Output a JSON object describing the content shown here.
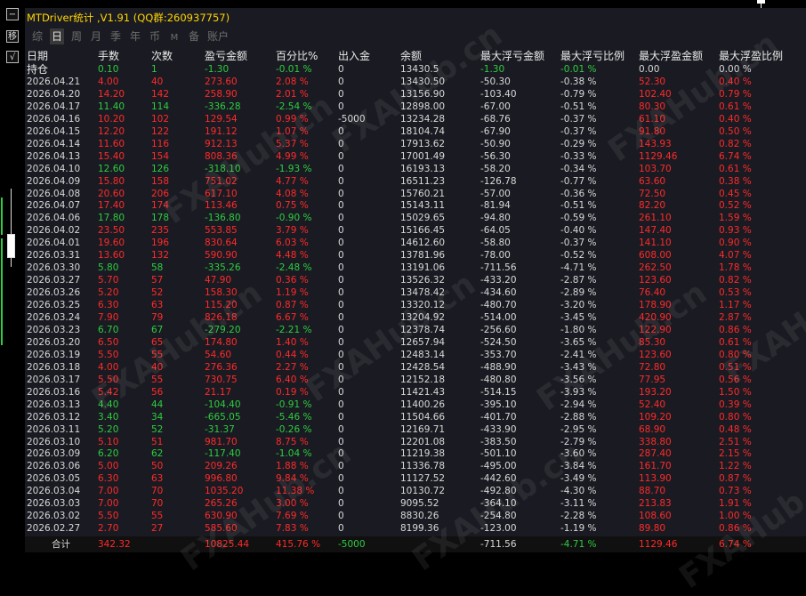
{
  "window": {
    "title": "MTDriver统计 ,V1.91 (QQ群:260937757)",
    "side_buttons": [
      "−",
      "移",
      "√"
    ]
  },
  "tabs": [
    {
      "label": "综",
      "active": false,
      "small": false
    },
    {
      "label": "日",
      "active": true,
      "small": false
    },
    {
      "label": "周",
      "active": false,
      "small": false
    },
    {
      "label": "月",
      "active": false,
      "small": false
    },
    {
      "label": "季",
      "active": false,
      "small": false
    },
    {
      "label": "年",
      "active": false,
      "small": false
    },
    {
      "label": "币",
      "active": false,
      "small": false
    },
    {
      "label": "M",
      "active": false,
      "small": true
    },
    {
      "label": "备",
      "active": false,
      "small": false
    },
    {
      "label": "账户",
      "active": false,
      "small": false
    }
  ],
  "columns": [
    "日期",
    "手数",
    "次数",
    "盈亏金额",
    "百分比%",
    "出入金",
    "余额",
    "最大浮亏金额",
    "最大浮亏比例",
    "最大浮盈金额",
    "最大浮盈比例"
  ],
  "holding": {
    "date": "持仓",
    "lots": "0.10",
    "count": "1",
    "pnl": "-1.30",
    "pct": "-0.01 %",
    "io": "0",
    "balance": "13430.5",
    "max_loss": "-1.30",
    "max_loss_pct": "-0.01 %",
    "max_profit": "0.00",
    "max_profit_pct": "0.00 %"
  },
  "rows": [
    {
      "date": "2026.04.21",
      "lots": "4.00",
      "count": "40",
      "pnl": "273.60",
      "pct": "2.08 %",
      "io": "0",
      "balance": "13430.50",
      "max_loss": "-50.30",
      "max_loss_pct": "-0.38 %",
      "max_profit": "52.30",
      "max_profit_pct": "0.40 %"
    },
    {
      "date": "2026.04.20",
      "lots": "14.20",
      "count": "142",
      "pnl": "258.90",
      "pct": "2.01 %",
      "io": "0",
      "balance": "13156.90",
      "max_loss": "-103.40",
      "max_loss_pct": "-0.79 %",
      "max_profit": "102.40",
      "max_profit_pct": "0.79 %"
    },
    {
      "date": "2026.04.17",
      "lots": "11.40",
      "count": "114",
      "pnl": "-336.28",
      "pct": "-2.54 %",
      "io": "0",
      "balance": "12898.00",
      "max_loss": "-67.00",
      "max_loss_pct": "-0.51 %",
      "max_profit": "80.30",
      "max_profit_pct": "0.61 %"
    },
    {
      "date": "2026.04.16",
      "lots": "10.20",
      "count": "102",
      "pnl": "129.54",
      "pct": "0.99 %",
      "io": "-5000",
      "balance": "13234.28",
      "max_loss": "-68.76",
      "max_loss_pct": "-0.37 %",
      "max_profit": "61.10",
      "max_profit_pct": "0.40 %"
    },
    {
      "date": "2026.04.15",
      "lots": "12.20",
      "count": "122",
      "pnl": "191.12",
      "pct": "1.07 %",
      "io": "0",
      "balance": "18104.74",
      "max_loss": "-67.90",
      "max_loss_pct": "-0.37 %",
      "max_profit": "91.80",
      "max_profit_pct": "0.50 %"
    },
    {
      "date": "2026.04.14",
      "lots": "11.60",
      "count": "116",
      "pnl": "912.13",
      "pct": "5.37 %",
      "io": "0",
      "balance": "17913.62",
      "max_loss": "-50.90",
      "max_loss_pct": "-0.29 %",
      "max_profit": "143.93",
      "max_profit_pct": "0.82 %"
    },
    {
      "date": "2026.04.13",
      "lots": "15.40",
      "count": "154",
      "pnl": "808.36",
      "pct": "4.99 %",
      "io": "0",
      "balance": "17001.49",
      "max_loss": "-56.30",
      "max_loss_pct": "-0.33 %",
      "max_profit": "1129.46",
      "max_profit_pct": "6.74 %"
    },
    {
      "date": "2026.04.10",
      "lots": "12.60",
      "count": "126",
      "pnl": "-318.10",
      "pct": "-1.93 %",
      "io": "0",
      "balance": "16193.13",
      "max_loss": "-58.20",
      "max_loss_pct": "-0.34 %",
      "max_profit": "103.70",
      "max_profit_pct": "0.61 %"
    },
    {
      "date": "2026.04.09",
      "lots": "15.80",
      "count": "158",
      "pnl": "751.02",
      "pct": "4.77 %",
      "io": "0",
      "balance": "16511.23",
      "max_loss": "-126.78",
      "max_loss_pct": "-0.77 %",
      "max_profit": "63.60",
      "max_profit_pct": "0.38 %"
    },
    {
      "date": "2026.04.08",
      "lots": "20.60",
      "count": "206",
      "pnl": "617.10",
      "pct": "4.08 %",
      "io": "0",
      "balance": "15760.21",
      "max_loss": "-57.00",
      "max_loss_pct": "-0.36 %",
      "max_profit": "72.50",
      "max_profit_pct": "0.45 %"
    },
    {
      "date": "2026.04.07",
      "lots": "17.40",
      "count": "174",
      "pnl": "113.46",
      "pct": "0.75 %",
      "io": "0",
      "balance": "15143.11",
      "max_loss": "-81.94",
      "max_loss_pct": "-0.51 %",
      "max_profit": "82.20",
      "max_profit_pct": "0.52 %"
    },
    {
      "date": "2026.04.06",
      "lots": "17.80",
      "count": "178",
      "pnl": "-136.80",
      "pct": "-0.90 %",
      "io": "0",
      "balance": "15029.65",
      "max_loss": "-94.80",
      "max_loss_pct": "-0.59 %",
      "max_profit": "261.10",
      "max_profit_pct": "1.59 %"
    },
    {
      "date": "2026.04.02",
      "lots": "23.50",
      "count": "235",
      "pnl": "553.85",
      "pct": "3.79 %",
      "io": "0",
      "balance": "15166.45",
      "max_loss": "-64.05",
      "max_loss_pct": "-0.40 %",
      "max_profit": "147.40",
      "max_profit_pct": "0.93 %"
    },
    {
      "date": "2026.04.01",
      "lots": "19.60",
      "count": "196",
      "pnl": "830.64",
      "pct": "6.03 %",
      "io": "0",
      "balance": "14612.60",
      "max_loss": "-58.80",
      "max_loss_pct": "-0.37 %",
      "max_profit": "141.10",
      "max_profit_pct": "0.90 %"
    },
    {
      "date": "2026.03.31",
      "lots": "13.60",
      "count": "132",
      "pnl": "590.90",
      "pct": "4.48 %",
      "io": "0",
      "balance": "13781.96",
      "max_loss": "-78.00",
      "max_loss_pct": "-0.52 %",
      "max_profit": "608.00",
      "max_profit_pct": "4.07 %"
    },
    {
      "date": "2026.03.30",
      "lots": "5.80",
      "count": "58",
      "pnl": "-335.26",
      "pct": "-2.48 %",
      "io": "0",
      "balance": "13191.06",
      "max_loss": "-711.56",
      "max_loss_pct": "-4.71 %",
      "max_profit": "262.50",
      "max_profit_pct": "1.78 %"
    },
    {
      "date": "2026.03.27",
      "lots": "5.70",
      "count": "57",
      "pnl": "47.90",
      "pct": "0.36 %",
      "io": "0",
      "balance": "13526.32",
      "max_loss": "-433.20",
      "max_loss_pct": "-2.87 %",
      "max_profit": "123.60",
      "max_profit_pct": "0.82 %"
    },
    {
      "date": "2026.03.26",
      "lots": "5.20",
      "count": "52",
      "pnl": "158.30",
      "pct": "1.19 %",
      "io": "0",
      "balance": "13478.42",
      "max_loss": "-434.60",
      "max_loss_pct": "-2.89 %",
      "max_profit": "76.40",
      "max_profit_pct": "0.53 %"
    },
    {
      "date": "2026.03.25",
      "lots": "6.30",
      "count": "63",
      "pnl": "115.20",
      "pct": "0.87 %",
      "io": "0",
      "balance": "13320.12",
      "max_loss": "-480.70",
      "max_loss_pct": "-3.20 %",
      "max_profit": "178.90",
      "max_profit_pct": "1.17 %"
    },
    {
      "date": "2026.03.24",
      "lots": "7.90",
      "count": "79",
      "pnl": "826.18",
      "pct": "6.67 %",
      "io": "0",
      "balance": "13204.92",
      "max_loss": "-514.00",
      "max_loss_pct": "-3.45 %",
      "max_profit": "420.90",
      "max_profit_pct": "2.87 %"
    },
    {
      "date": "2026.03.23",
      "lots": "6.70",
      "count": "67",
      "pnl": "-279.20",
      "pct": "-2.21 %",
      "io": "0",
      "balance": "12378.74",
      "max_loss": "-256.60",
      "max_loss_pct": "-1.80 %",
      "max_profit": "122.90",
      "max_profit_pct": "0.86 %"
    },
    {
      "date": "2026.03.20",
      "lots": "6.50",
      "count": "65",
      "pnl": "174.80",
      "pct": "1.40 %",
      "io": "0",
      "balance": "12657.94",
      "max_loss": "-524.50",
      "max_loss_pct": "-3.65 %",
      "max_profit": "85.30",
      "max_profit_pct": "0.61 %"
    },
    {
      "date": "2026.03.19",
      "lots": "5.50",
      "count": "55",
      "pnl": "54.60",
      "pct": "0.44 %",
      "io": "0",
      "balance": "12483.14",
      "max_loss": "-353.70",
      "max_loss_pct": "-2.41 %",
      "max_profit": "123.60",
      "max_profit_pct": "0.80 %"
    },
    {
      "date": "2026.03.18",
      "lots": "4.00",
      "count": "40",
      "pnl": "276.36",
      "pct": "2.27 %",
      "io": "0",
      "balance": "12428.54",
      "max_loss": "-488.90",
      "max_loss_pct": "-3.43 %",
      "max_profit": "72.80",
      "max_profit_pct": "0.51 %"
    },
    {
      "date": "2026.03.17",
      "lots": "5.50",
      "count": "55",
      "pnl": "730.75",
      "pct": "6.40 %",
      "io": "0",
      "balance": "12152.18",
      "max_loss": "-480.80",
      "max_loss_pct": "-3.56 %",
      "max_profit": "77.95",
      "max_profit_pct": "0.56 %"
    },
    {
      "date": "2026.03.16",
      "lots": "5.42",
      "count": "56",
      "pnl": "21.17",
      "pct": "0.19 %",
      "io": "0",
      "balance": "11421.43",
      "max_loss": "-514.15",
      "max_loss_pct": "-3.93 %",
      "max_profit": "193.20",
      "max_profit_pct": "1.50 %"
    },
    {
      "date": "2026.03.13",
      "lots": "4.40",
      "count": "44",
      "pnl": "-104.40",
      "pct": "-0.91 %",
      "io": "0",
      "balance": "11400.26",
      "max_loss": "-395.10",
      "max_loss_pct": "-2.94 %",
      "max_profit": "52.40",
      "max_profit_pct": "0.39 %"
    },
    {
      "date": "2026.03.12",
      "lots": "3.40",
      "count": "34",
      "pnl": "-665.05",
      "pct": "-5.46 %",
      "io": "0",
      "balance": "11504.66",
      "max_loss": "-401.70",
      "max_loss_pct": "-2.88 %",
      "max_profit": "109.20",
      "max_profit_pct": "0.80 %"
    },
    {
      "date": "2026.03.11",
      "lots": "5.20",
      "count": "52",
      "pnl": "-31.37",
      "pct": "-0.26 %",
      "io": "0",
      "balance": "12169.71",
      "max_loss": "-433.90",
      "max_loss_pct": "-2.95 %",
      "max_profit": "68.90",
      "max_profit_pct": "0.48 %"
    },
    {
      "date": "2026.03.10",
      "lots": "5.10",
      "count": "51",
      "pnl": "981.70",
      "pct": "8.75 %",
      "io": "0",
      "balance": "12201.08",
      "max_loss": "-383.50",
      "max_loss_pct": "-2.79 %",
      "max_profit": "338.80",
      "max_profit_pct": "2.51 %"
    },
    {
      "date": "2026.03.09",
      "lots": "6.20",
      "count": "62",
      "pnl": "-117.40",
      "pct": "-1.04 %",
      "io": "0",
      "balance": "11219.38",
      "max_loss": "-501.10",
      "max_loss_pct": "-3.60 %",
      "max_profit": "287.40",
      "max_profit_pct": "2.15 %"
    },
    {
      "date": "2026.03.06",
      "lots": "5.00",
      "count": "50",
      "pnl": "209.26",
      "pct": "1.88 %",
      "io": "0",
      "balance": "11336.78",
      "max_loss": "-495.00",
      "max_loss_pct": "-3.84 %",
      "max_profit": "161.70",
      "max_profit_pct": "1.22 %"
    },
    {
      "date": "2026.03.05",
      "lots": "6.30",
      "count": "63",
      "pnl": "996.80",
      "pct": "9.84 %",
      "io": "0",
      "balance": "11127.52",
      "max_loss": "-442.60",
      "max_loss_pct": "-3.49 %",
      "max_profit": "113.90",
      "max_profit_pct": "0.87 %"
    },
    {
      "date": "2026.03.04",
      "lots": "7.00",
      "count": "70",
      "pnl": "1035.20",
      "pct": "11.38 %",
      "io": "0",
      "balance": "10130.72",
      "max_loss": "-492.80",
      "max_loss_pct": "-4.30 %",
      "max_profit": "88.70",
      "max_profit_pct": "0.73 %"
    },
    {
      "date": "2026.03.03",
      "lots": "7.00",
      "count": "70",
      "pnl": "265.26",
      "pct": "3.00 %",
      "io": "0",
      "balance": "9095.52",
      "max_loss": "-364.10",
      "max_loss_pct": "-3.11 %",
      "max_profit": "213.83",
      "max_profit_pct": "1.91 %"
    },
    {
      "date": "2026.03.02",
      "lots": "5.50",
      "count": "55",
      "pnl": "630.90",
      "pct": "7.69 %",
      "io": "0",
      "balance": "8830.26",
      "max_loss": "-254.80",
      "max_loss_pct": "-2.28 %",
      "max_profit": "108.60",
      "max_profit_pct": "1.00 %"
    },
    {
      "date": "2026.02.27",
      "lots": "2.70",
      "count": "27",
      "pnl": "585.60",
      "pct": "7.83 %",
      "io": "0",
      "balance": "8199.36",
      "max_loss": "-123.00",
      "max_loss_pct": "-1.19 %",
      "max_profit": "89.80",
      "max_profit_pct": "0.86 %"
    }
  ],
  "total": {
    "label": "合计",
    "lots": "342.32",
    "pnl": "10825.44",
    "pct": "415.76 %",
    "io": "-5000",
    "max_loss": "-711.56",
    "max_loss_pct": "-4.71 %",
    "max_profit": "1129.46",
    "max_profit_pct": "6.74 %"
  },
  "watermark": "FXAHub.cn",
  "colors": {
    "profit": "#ff2a2a",
    "loss": "#2ecc40",
    "title": "#ffd400",
    "panel": "#1a1b22"
  }
}
